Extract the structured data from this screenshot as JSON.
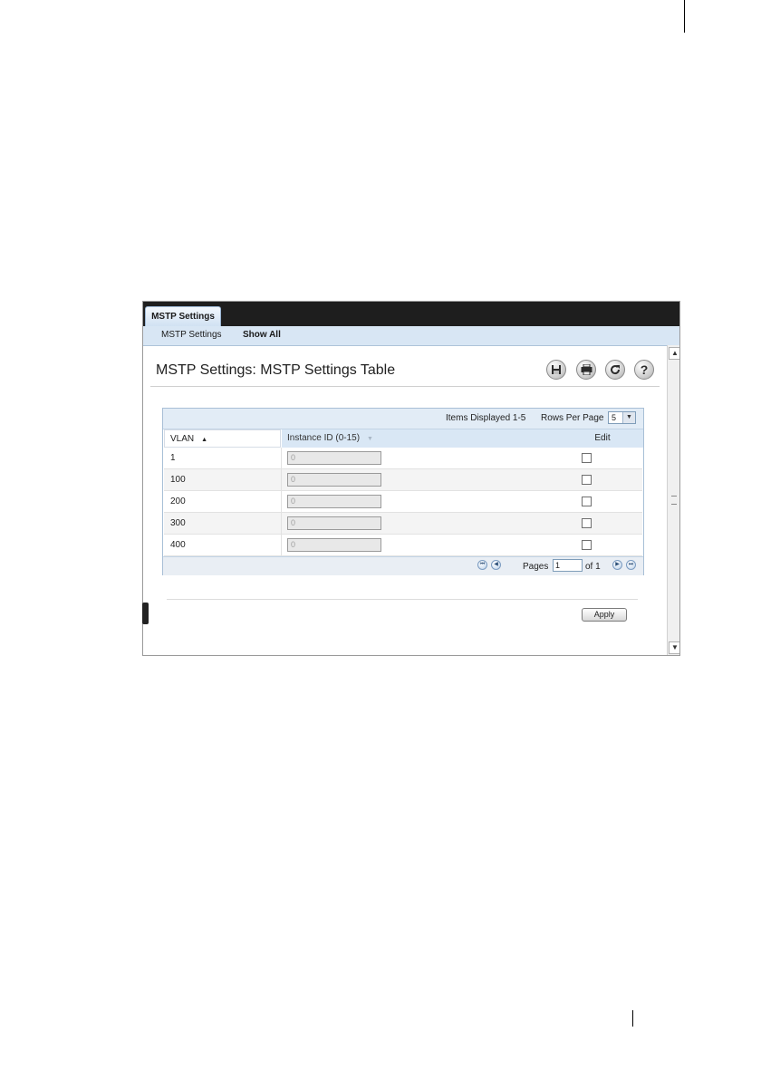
{
  "tabs": {
    "active": "MSTP Settings"
  },
  "subnav": {
    "item1": "MSTP Settings",
    "item2": "Show All"
  },
  "page": {
    "title": "MSTP Settings: MSTP Settings Table"
  },
  "toolbar": {
    "icons": [
      "save-icon",
      "print-icon",
      "refresh-icon",
      "help-icon"
    ]
  },
  "table": {
    "items_displayed": "Items Displayed 1-5",
    "rows_per_page_label": "Rows Per Page",
    "rows_per_page_value": "5",
    "columns": {
      "vlan": "VLAN",
      "instance": "Instance ID (0-15)",
      "edit": "Edit"
    },
    "rows": [
      {
        "vlan": "1",
        "instance": "0",
        "edit": false
      },
      {
        "vlan": "100",
        "instance": "0",
        "edit": false
      },
      {
        "vlan": "200",
        "instance": "0",
        "edit": false
      },
      {
        "vlan": "300",
        "instance": "0",
        "edit": false
      },
      {
        "vlan": "400",
        "instance": "0",
        "edit": false
      }
    ],
    "pagination": {
      "pages_label": "Pages",
      "current_page": "1",
      "of_label": "of 1"
    }
  },
  "actions": {
    "apply_label": "Apply"
  }
}
